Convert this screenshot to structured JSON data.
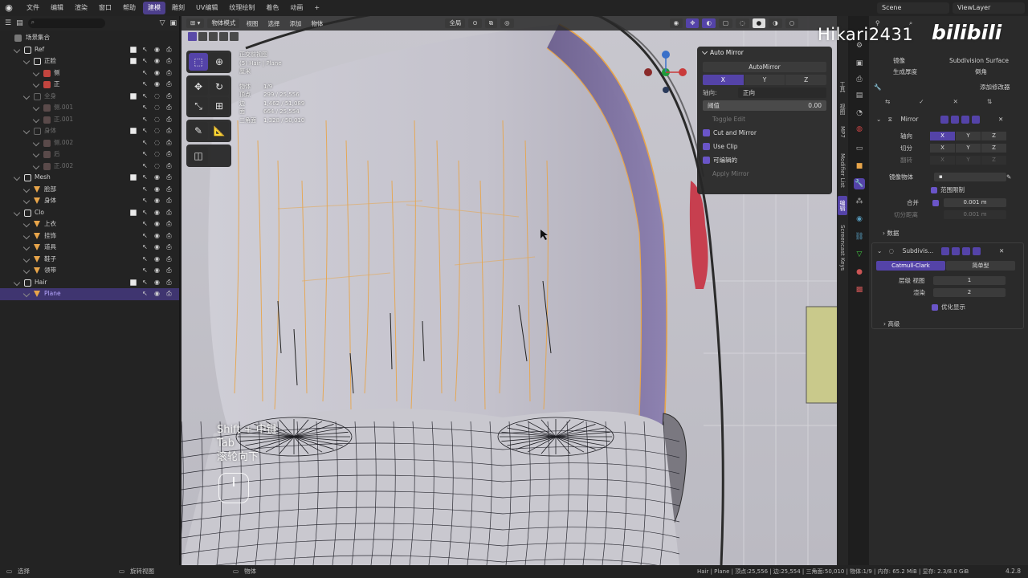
{
  "topbar": {
    "menus": [
      "文件",
      "编辑",
      "渲染",
      "窗口",
      "帮助"
    ],
    "workspaces": [
      "建模",
      "雕刻",
      "UV编辑",
      "纹理绘制",
      "着色",
      "动画"
    ],
    "active_workspace": "建模",
    "add_tab": "+",
    "scene": "Scene",
    "view_layer": "ViewLayer"
  },
  "outliner": {
    "search_placeholder": "",
    "root": "场景集合",
    "rows": [
      {
        "label": "Ref",
        "indent": 1,
        "type": "collection",
        "vis": true
      },
      {
        "label": "正脸",
        "indent": 2,
        "type": "collection",
        "vis": true
      },
      {
        "label": "侧",
        "indent": 3,
        "type": "image",
        "vis": true
      },
      {
        "label": "正",
        "indent": 3,
        "type": "image",
        "vis": true
      },
      {
        "label": "全身",
        "indent": 2,
        "type": "collection",
        "vis": false
      },
      {
        "label": "侧.001",
        "indent": 3,
        "type": "image",
        "vis": false
      },
      {
        "label": "正.001",
        "indent": 3,
        "type": "image",
        "vis": false
      },
      {
        "label": "身体",
        "indent": 2,
        "type": "collection",
        "vis": false
      },
      {
        "label": "侧.002",
        "indent": 3,
        "type": "image",
        "vis": false
      },
      {
        "label": "后",
        "indent": 3,
        "type": "image",
        "vis": false
      },
      {
        "label": "正.002",
        "indent": 3,
        "type": "image",
        "vis": false
      },
      {
        "label": "Mesh",
        "indent": 1,
        "type": "collection",
        "vis": true
      },
      {
        "label": "脸部",
        "indent": 2,
        "type": "mesh",
        "vis": true,
        "muted": true
      },
      {
        "label": "身体",
        "indent": 2,
        "type": "mesh",
        "vis": true
      },
      {
        "label": "Clo",
        "indent": 1,
        "type": "collection",
        "vis": true
      },
      {
        "label": "上衣",
        "indent": 2,
        "type": "mesh",
        "vis": true
      },
      {
        "label": "挂饰",
        "indent": 2,
        "type": "mesh",
        "vis": true
      },
      {
        "label": "道具",
        "indent": 2,
        "type": "mesh",
        "vis": true
      },
      {
        "label": "鞋子",
        "indent": 2,
        "type": "mesh",
        "vis": true
      },
      {
        "label": "领带",
        "indent": 2,
        "type": "mesh",
        "vis": true
      },
      {
        "label": "Hair",
        "indent": 1,
        "type": "collection",
        "vis": true
      },
      {
        "label": "Plane",
        "indent": 2,
        "type": "mesh",
        "vis": true,
        "selected": true
      }
    ]
  },
  "viewport": {
    "header": {
      "mode": "物体模式",
      "menus": [
        "视图",
        "选择",
        "添加",
        "物体"
      ],
      "orientation": "全局"
    },
    "info": {
      "view": "正交前视图",
      "object": "(5) Hair | Plane",
      "unit": "厘米",
      "stats": [
        {
          "k": "物体",
          "v": "1/9"
        },
        {
          "k": "顶点",
          "v": "299 / 25,556"
        },
        {
          "k": "边",
          "v": "1,462 / 51,089"
        },
        {
          "k": "面",
          "v": "664 / 25,554"
        },
        {
          "k": "三角面",
          "v": "1,328 / 50,010"
        }
      ]
    },
    "keycast": [
      "Shift + 中键",
      "Tab",
      "滚轮向下"
    ]
  },
  "auto_mirror": {
    "title": "Auto Mirror",
    "button": "AutoMirror",
    "axes": [
      "X",
      "Y",
      "Z"
    ],
    "active_axis": "X",
    "orientation_label": "轴向:",
    "orientation_value": "正向",
    "threshold_label": "阈值",
    "threshold_value": "0.00",
    "toggle_edit": "Toggle Edit",
    "cut_and_mirror": "Cut and Mirror",
    "use_clip": "Use Clip",
    "editable": "可编辑的",
    "apply_mirror": "Apply Mirror"
  },
  "side_tabs": [
    "工具",
    "视图",
    "MP7",
    "Modifier List",
    "编辑",
    "Screencast Keys"
  ],
  "properties": {
    "top_left_1": "镜像",
    "top_left_2": "生成厚度",
    "top_right_1": "Subdivision Surface",
    "top_right_2": "倒角",
    "add_modifier": "添加修改器",
    "mirror": {
      "name": "Mirror",
      "axis_label": "轴向",
      "bisect_label": "切分",
      "flip_label": "翻转",
      "axes": [
        "X",
        "Y",
        "Z"
      ],
      "mirror_object_label": "镜像物体",
      "clipping_label": "范围限制",
      "merge_label": "合并",
      "merge_value": "0.001 m",
      "bisect_distance_label": "切分距离",
      "bisect_distance_value": "0.001 m",
      "data_label": "数据"
    },
    "subdiv": {
      "name": "Subdivis...",
      "catmull": "Catmull-Clark",
      "simple": "简单型",
      "levels_viewport_label": "层级 视图",
      "levels_viewport_value": "1",
      "render_label": "渲染",
      "render_value": "2",
      "optimal_display": "优化显示",
      "advanced": "高级"
    }
  },
  "statusbar": {
    "select": "选择",
    "rotate_view": "旋转视图",
    "object": "物体",
    "stats": "Hair | Plane | 顶点:25,556 | 边:25,554 | 三角面:50,010 | 物体:1/9 | 内存: 65.2 MiB | 显存: 2.3/8.0 GiB",
    "version": "4.2.8"
  },
  "watermark": {
    "user": "Hikari2431",
    "brand": "bilibili"
  },
  "colors": {
    "accent": "#5443a8",
    "selection": "#3f3570",
    "mesh_orange": "#e8a54a"
  }
}
